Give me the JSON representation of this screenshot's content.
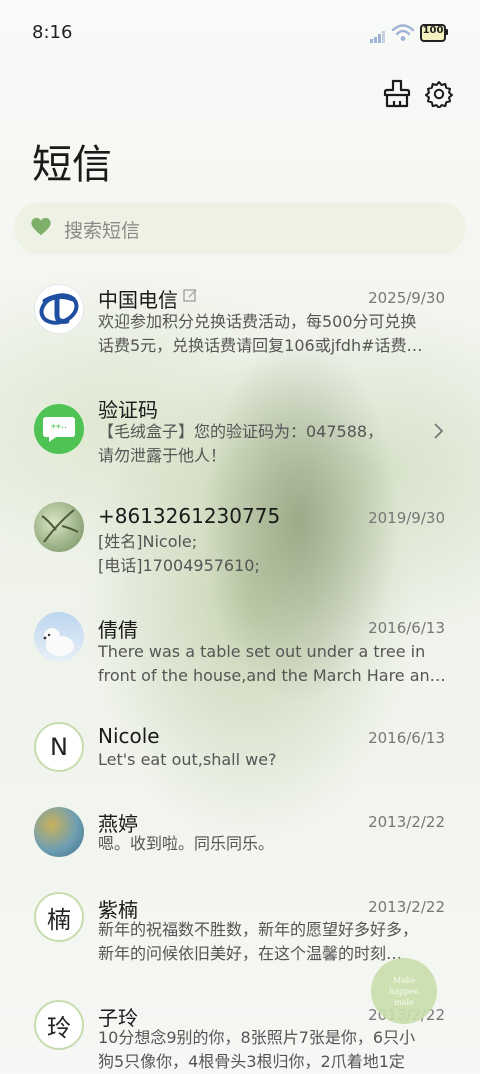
{
  "status_bar": {
    "time": "8:16",
    "battery": "100"
  },
  "header": {
    "title": "短信"
  },
  "search": {
    "placeholder": "搜索短信"
  },
  "conversations": [
    {
      "name": "中国电信",
      "date": "2025/9/30",
      "line1": "欢迎参加积分兑换话费活动，每500分可兑换",
      "line2": "话费5元，兑换话费请回复106或jfdh#话费…"
    },
    {
      "name": "验证码",
      "date": "",
      "line1": "【毛绒盒子】您的验证码为：047588，",
      "line2": "请勿泄露于他人！"
    },
    {
      "name": "+8613261230775",
      "date": "2019/9/30",
      "line1": "[姓名]Nicole;",
      "line2": "[电话]17004957610;"
    },
    {
      "name": "倩倩",
      "date": "2016/6/13",
      "line1": "There was a table set out under a tree in",
      "line2": "front of the house,and the March Hare an…"
    },
    {
      "name": "Nicole",
      "date": "2016/6/13",
      "avatar_letter": "N",
      "line1": "Let's eat out,shall we?"
    },
    {
      "name": "燕婷",
      "date": "2013/2/22",
      "line1": "嗯。收到啦。同乐同乐。"
    },
    {
      "name": "紫楠",
      "date": "2013/2/22",
      "avatar_letter": "楠",
      "line1": "新年的祝福数不胜数，新年的愿望好多好多，",
      "line2": "新年的问候依旧美好，在这个温馨的时刻…"
    },
    {
      "name": "子玲",
      "date": "2013/2/22",
      "avatar_letter": "玲",
      "line1": "10分想念9别的你，8张照片7张是你，6只小",
      "line2": "狗5只像你，4根骨头3根归你，2爪着地1定"
    }
  ],
  "fab": {
    "line1": "Make",
    "line2": "happen",
    "line3": "male"
  },
  "colors": {
    "accent": "#7fb069",
    "telecom": "#1f4fa0",
    "sms_green": "#4fc455"
  }
}
